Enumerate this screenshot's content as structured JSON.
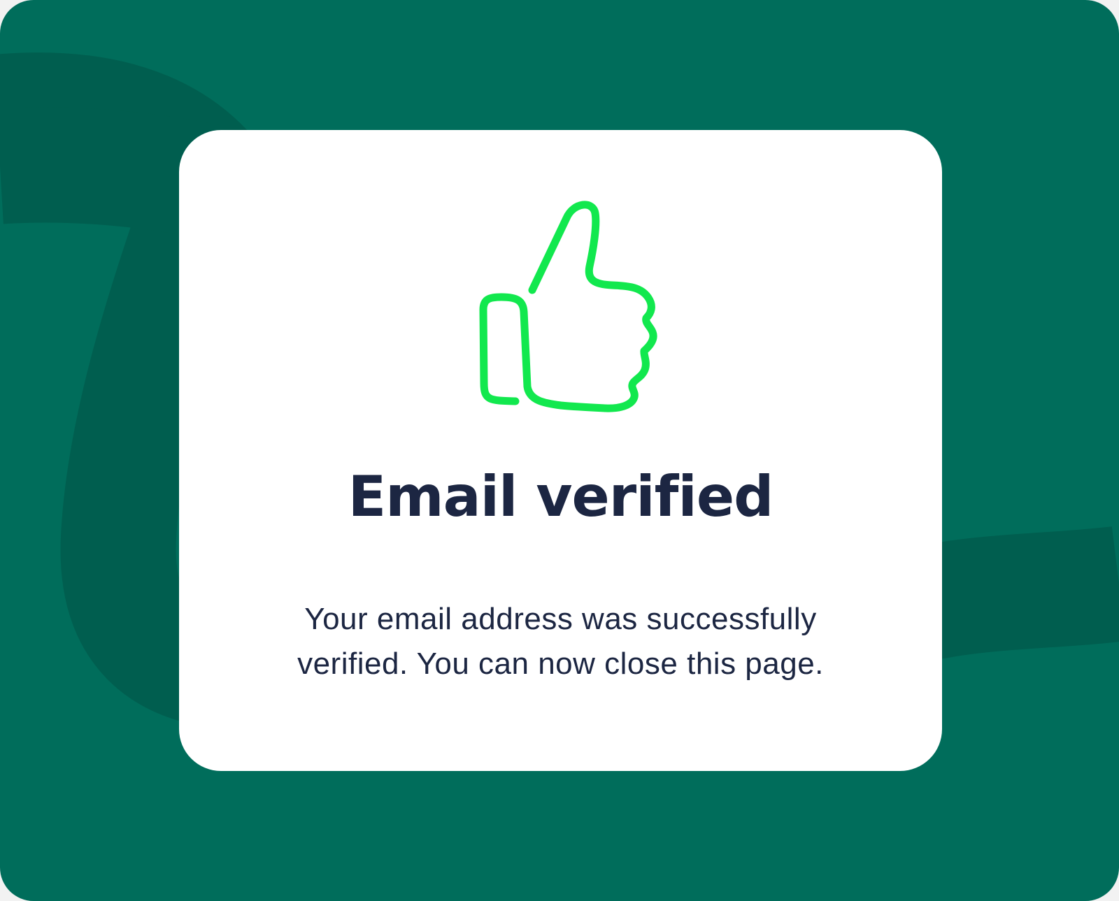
{
  "page": {
    "background_color": "#006d5b",
    "swoosh_color": "#005e4f",
    "card_color": "#ffffff"
  },
  "confirmation": {
    "icon": "thumbs-up-icon",
    "icon_color": "#12e84e",
    "title": "Email verified",
    "message": "Your email address was successfully verified. You can now close this page.",
    "text_color": "#1c2642"
  }
}
